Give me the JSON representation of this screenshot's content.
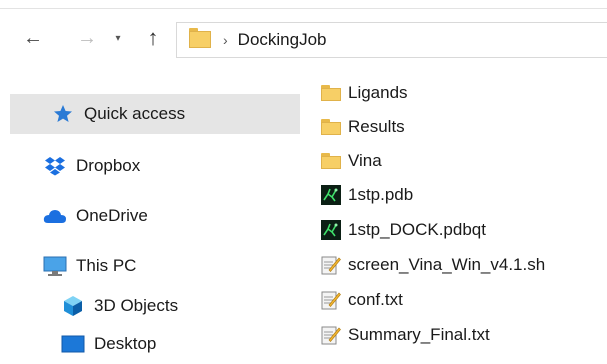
{
  "address_bar": {
    "separator": "›",
    "current_folder": "DockingJob"
  },
  "nav_glyphs": {
    "back": "←",
    "forward": "→",
    "recent": "▾",
    "up": "↑"
  },
  "sidebar": {
    "items": [
      {
        "label": "Quick access",
        "icon": "star-icon"
      },
      {
        "label": "Dropbox",
        "icon": "dropbox-icon"
      },
      {
        "label": "OneDrive",
        "icon": "onedrive-icon"
      },
      {
        "label": "This PC",
        "icon": "computer-icon"
      },
      {
        "label": "3D Objects",
        "icon": "3d-objects-icon"
      },
      {
        "label": "Desktop",
        "icon": "desktop-icon"
      }
    ]
  },
  "files": [
    {
      "name": "Ligands",
      "type": "folder"
    },
    {
      "name": "Results",
      "type": "folder"
    },
    {
      "name": "Vina",
      "type": "folder"
    },
    {
      "name": "1stp.pdb",
      "type": "pdb"
    },
    {
      "name": "1stp_DOCK.pdbqt",
      "type": "pdb"
    },
    {
      "name": "screen_Vina_Win_v4.1.sh",
      "type": "text"
    },
    {
      "name": "conf.txt",
      "type": "text"
    },
    {
      "name": "Summary_Final.txt",
      "type": "text"
    }
  ],
  "colors": {
    "folder": "#f7cf66",
    "selection": "#e5e5e5",
    "accent_blue": "#2a7ad5"
  }
}
